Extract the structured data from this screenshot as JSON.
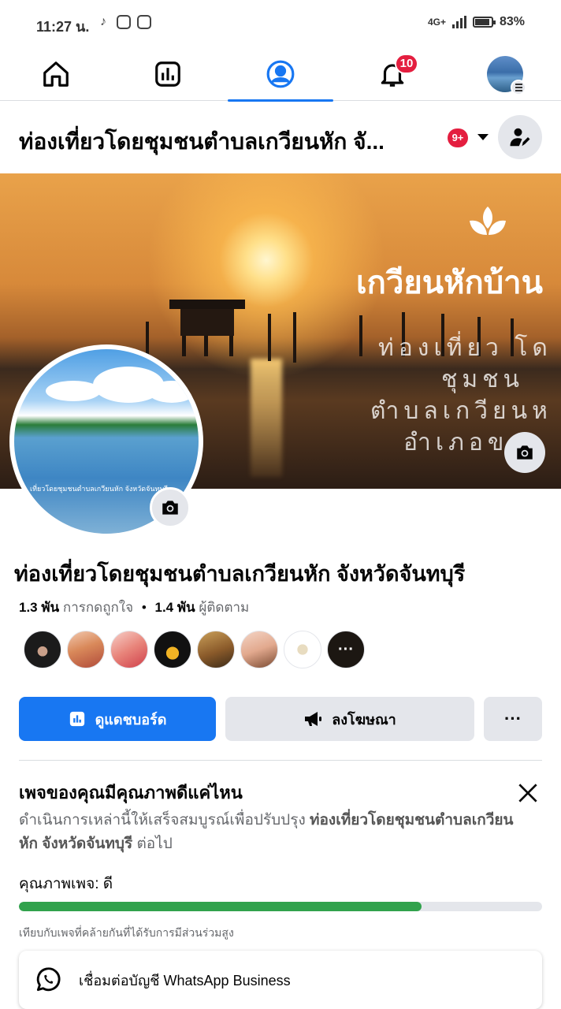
{
  "status_bar": {
    "time": "11:27 น.",
    "network": "4G+",
    "battery": "83%"
  },
  "nav": {
    "notifications_count": "10",
    "active_tab": "profile"
  },
  "page_header": {
    "title": "ท่องเที่ยวโดยชุมชนตำบลเกวียนหัก จั...",
    "badge": "9+"
  },
  "cover": {
    "brand_text": "เกวียนหักบ้าน",
    "sub_line1": "ท่องเที่ยว โด",
    "sub_line2": "ชุมชน",
    "sub_line3": "ตำบลเกวียนห",
    "sub_line4": "อำเภอขลุ"
  },
  "profile": {
    "caption": "เที่ยวโดยชุมชนตำบลเกวียนหัก จังหวัดจันทบุรี"
  },
  "page": {
    "name": "ท่องเที่ยวโดยชุมชนตำบลเกวียนหัก จังหวัดจันทบุรี",
    "likes_count": "1.3 พัน",
    "likes_label": "การกดถูกใจ",
    "separator": "•",
    "followers_count": "1.4 พัน",
    "followers_label": "ผู้ติดตาม",
    "more_avatars": "···"
  },
  "actions": {
    "dashboard": "ดูแดชบอร์ด",
    "advertise": "ลงโฆษณา",
    "more": "···"
  },
  "quality": {
    "title": "เพจของคุณมีคุณภาพดีแค่ไหน",
    "desc_prefix": "ดำเนินการเหล่านี้ให้เสร็จสมบูรณ์เพื่อปรับปรุง ",
    "desc_page": "ท่องเที่ยวโดยชุมชนตำบลเกวียนหัก จังหวัดจันทบุรี",
    "desc_suffix": " ต่อไป",
    "label": "คุณภาพเพจ: ดี",
    "progress_percent": 77,
    "note": "เทียบกับเพจที่คล้ายกันที่ได้รับการมีส่วนร่วมสูง"
  },
  "whatsapp": {
    "label": "เชื่อมต่อบัญชี WhatsApp Business"
  },
  "colors": {
    "primary": "#1877f2",
    "badge": "#e41e3f",
    "progress": "#31a24c",
    "secondary_bg": "#e4e6eb"
  }
}
